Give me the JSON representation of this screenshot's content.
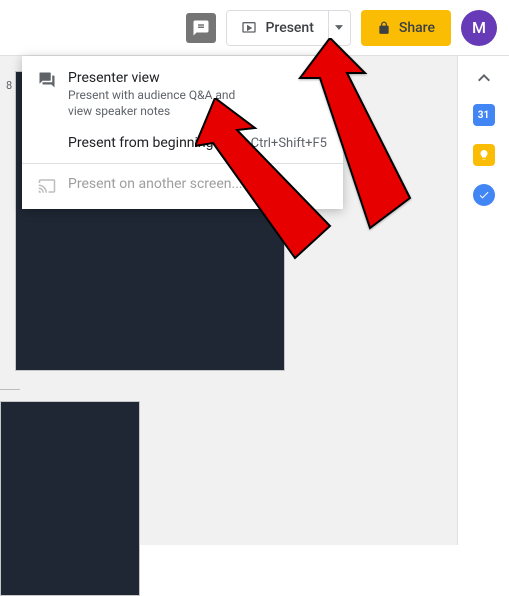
{
  "toolbar": {
    "present_label": "Present",
    "share_label": "Share",
    "avatar_letter": "M"
  },
  "dropdown": {
    "items": [
      {
        "label": "Presenter view",
        "sub": "Present with audience Q&A and view speaker notes"
      },
      {
        "label": "Present from beginning",
        "shortcut": "Ctrl+Shift+F5"
      },
      {
        "label": "Present on another screen..."
      }
    ]
  },
  "slide": {
    "number": "8"
  },
  "rail": {
    "calendar_day": "31"
  }
}
